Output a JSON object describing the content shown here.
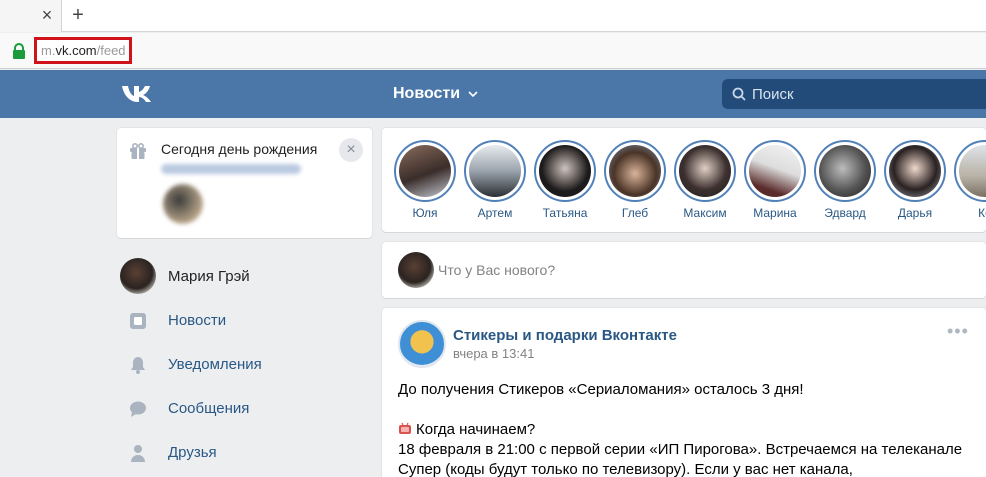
{
  "browser": {
    "tab_close_glyph": "×",
    "new_tab_glyph": "+",
    "url_prefix": "m.",
    "url_host": "vk.com",
    "url_path": "/feed"
  },
  "header": {
    "logo_icon": "vk-logo-icon",
    "nav_title": "Новости",
    "search_placeholder": "Поиск",
    "color": "#4a76a8"
  },
  "birthday": {
    "title": "Сегодня день рождения",
    "close_glyph": "×"
  },
  "sidebar": {
    "profile_name": "Мария Грэй",
    "items": [
      {
        "label": "Новости",
        "icon": "news-icon"
      },
      {
        "label": "Уведомления",
        "icon": "bell-icon"
      },
      {
        "label": "Сообщения",
        "icon": "message-icon"
      },
      {
        "label": "Друзья",
        "icon": "friends-icon"
      }
    ]
  },
  "stories": [
    {
      "name": "Юля"
    },
    {
      "name": "Артем"
    },
    {
      "name": "Татьяна"
    },
    {
      "name": "Глеб"
    },
    {
      "name": "Максим"
    },
    {
      "name": "Марина"
    },
    {
      "name": "Эдвард"
    },
    {
      "name": "Дарья"
    },
    {
      "name": "Ко"
    }
  ],
  "composer": {
    "placeholder": "Что у Вас нового?"
  },
  "post": {
    "author": "Стикеры и подарки Вконтакте",
    "time": "вчера в 13:41",
    "more_glyph": "•••",
    "lines": [
      "До получения Стикеров «Сериаломания» осталось 3 дня!",
      "Когда начинаем?",
      "18 февраля в 21:00 с первой серии «ИП Пирогова». Встречаемся на телеканале",
      "Супер (коды будут только по телевизору). Если у вас нет канала,"
    ]
  }
}
